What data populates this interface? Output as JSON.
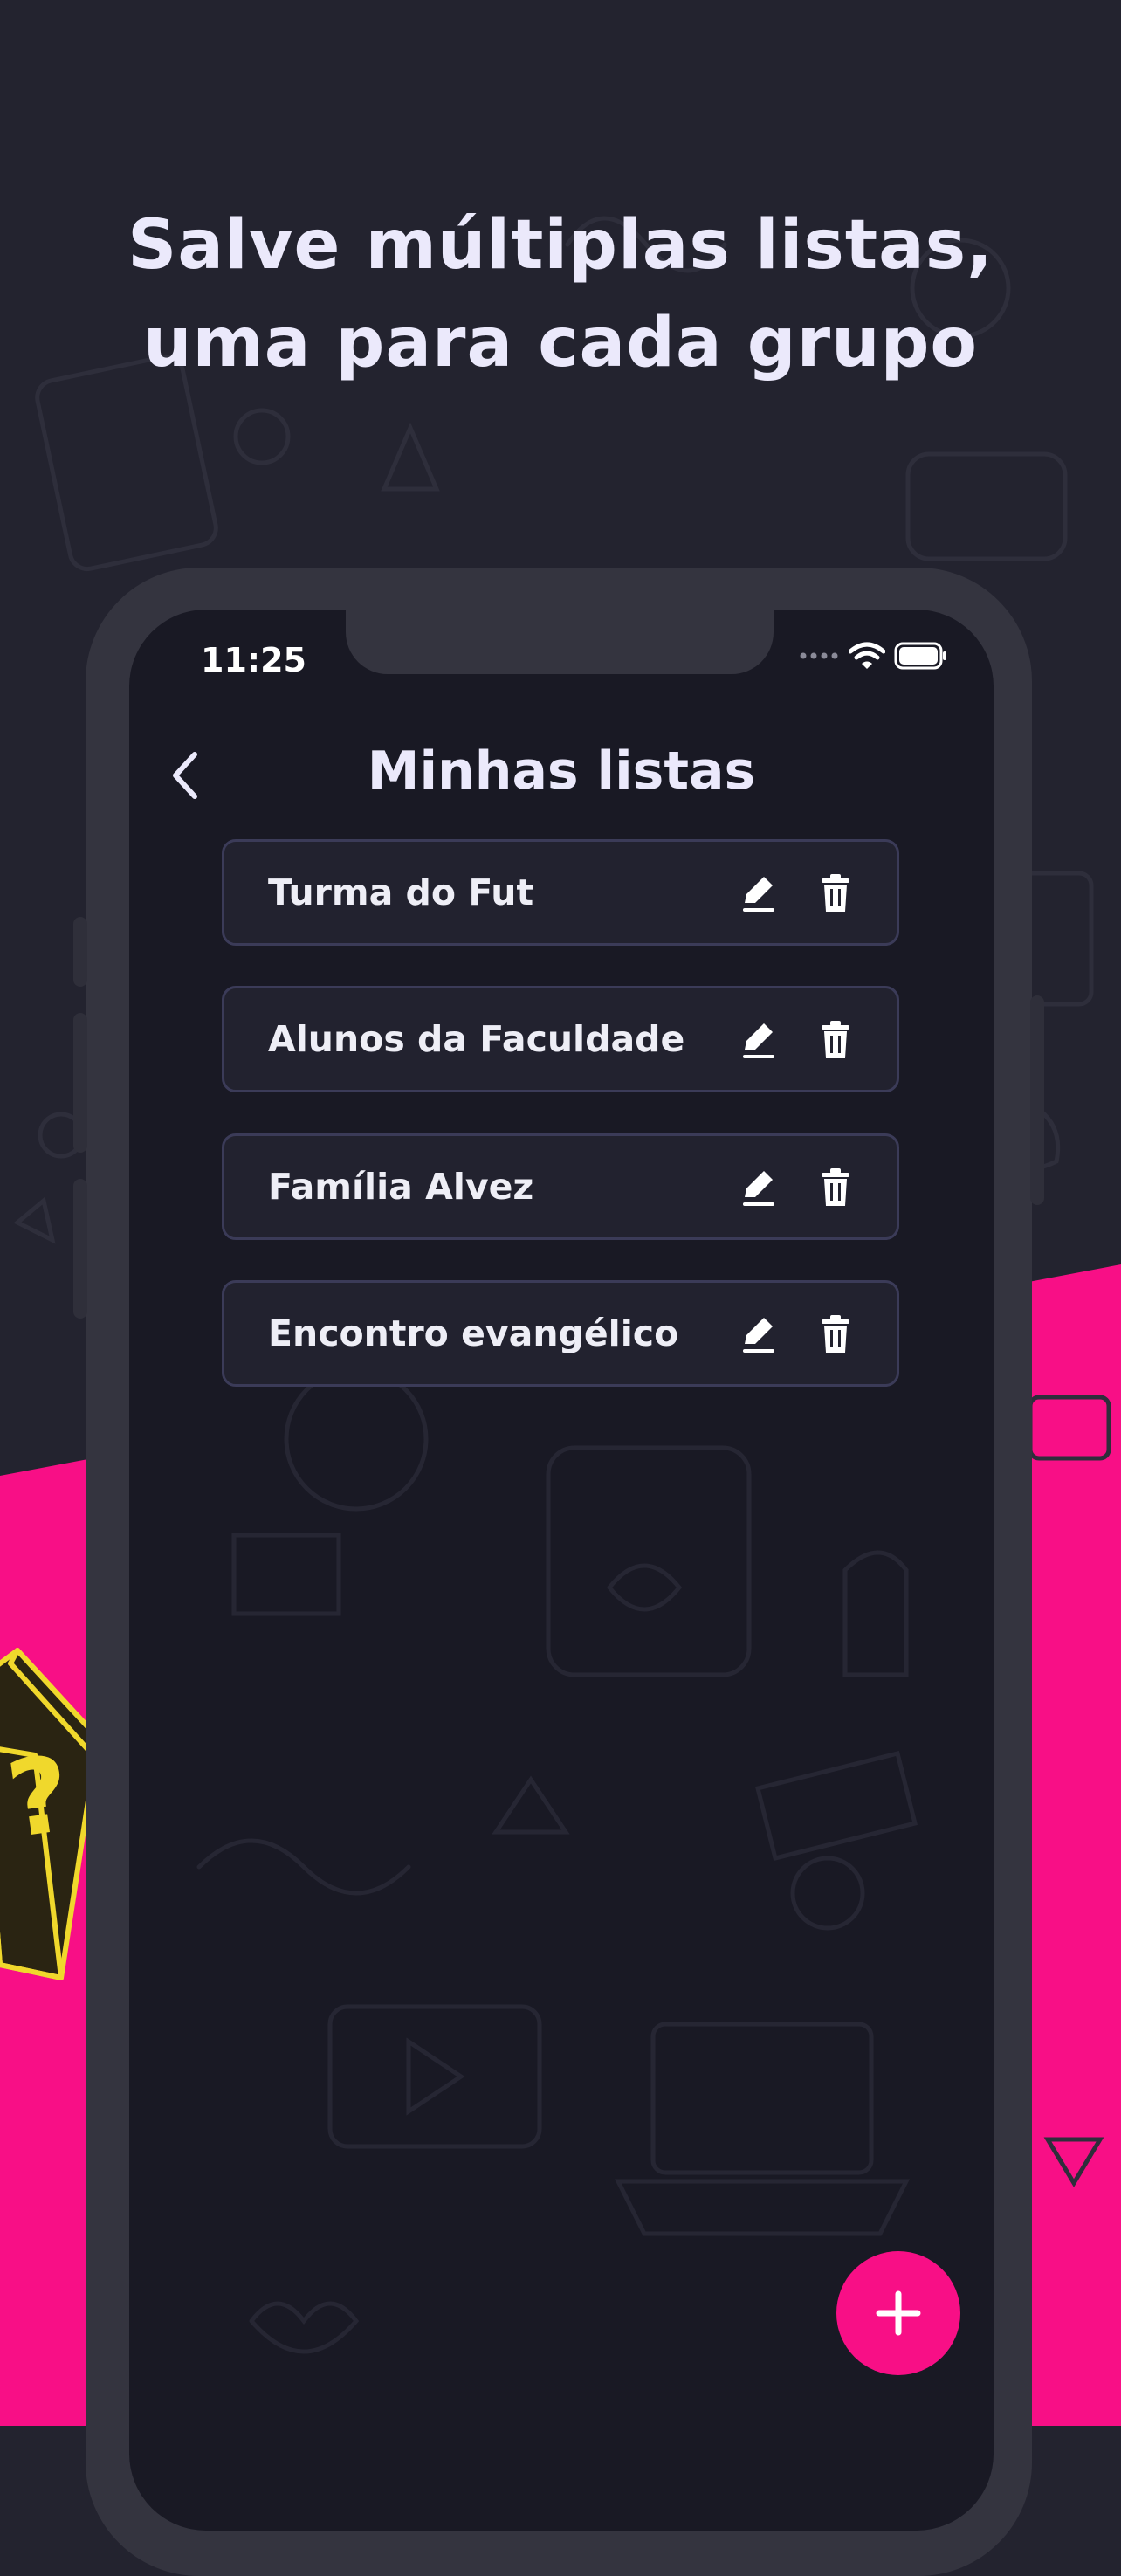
{
  "colors": {
    "background": "#23232f",
    "accent_pink": "#f80f86",
    "phone_frame": "#34343f",
    "screen_bg": "#191924",
    "card_bg": "#22222f",
    "card_border": "#3b3b58",
    "text_light": "#ebe9fb",
    "cube_yellow": "#f0d82c"
  },
  "promo": {
    "headline_line1": "Salve múltiplas listas,",
    "headline_line2": "uma para cada grupo"
  },
  "status_bar": {
    "time": "11:25",
    "icons": [
      "signal-dots-icon",
      "wifi-icon",
      "battery-icon"
    ]
  },
  "app_bar": {
    "back_icon": "chevron-left-icon",
    "title": "Minhas listas"
  },
  "lists": [
    {
      "name": "Turma do Fut",
      "edit_icon": "pencil-icon",
      "delete_icon": "trash-icon"
    },
    {
      "name": "Alunos da Faculdade",
      "edit_icon": "pencil-icon",
      "delete_icon": "trash-icon"
    },
    {
      "name": "Família Alvez",
      "edit_icon": "pencil-icon",
      "delete_icon": "trash-icon"
    },
    {
      "name": "Encontro evangélico",
      "edit_icon": "pencil-icon",
      "delete_icon": "trash-icon"
    }
  ],
  "fab": {
    "icon": "plus-icon"
  }
}
